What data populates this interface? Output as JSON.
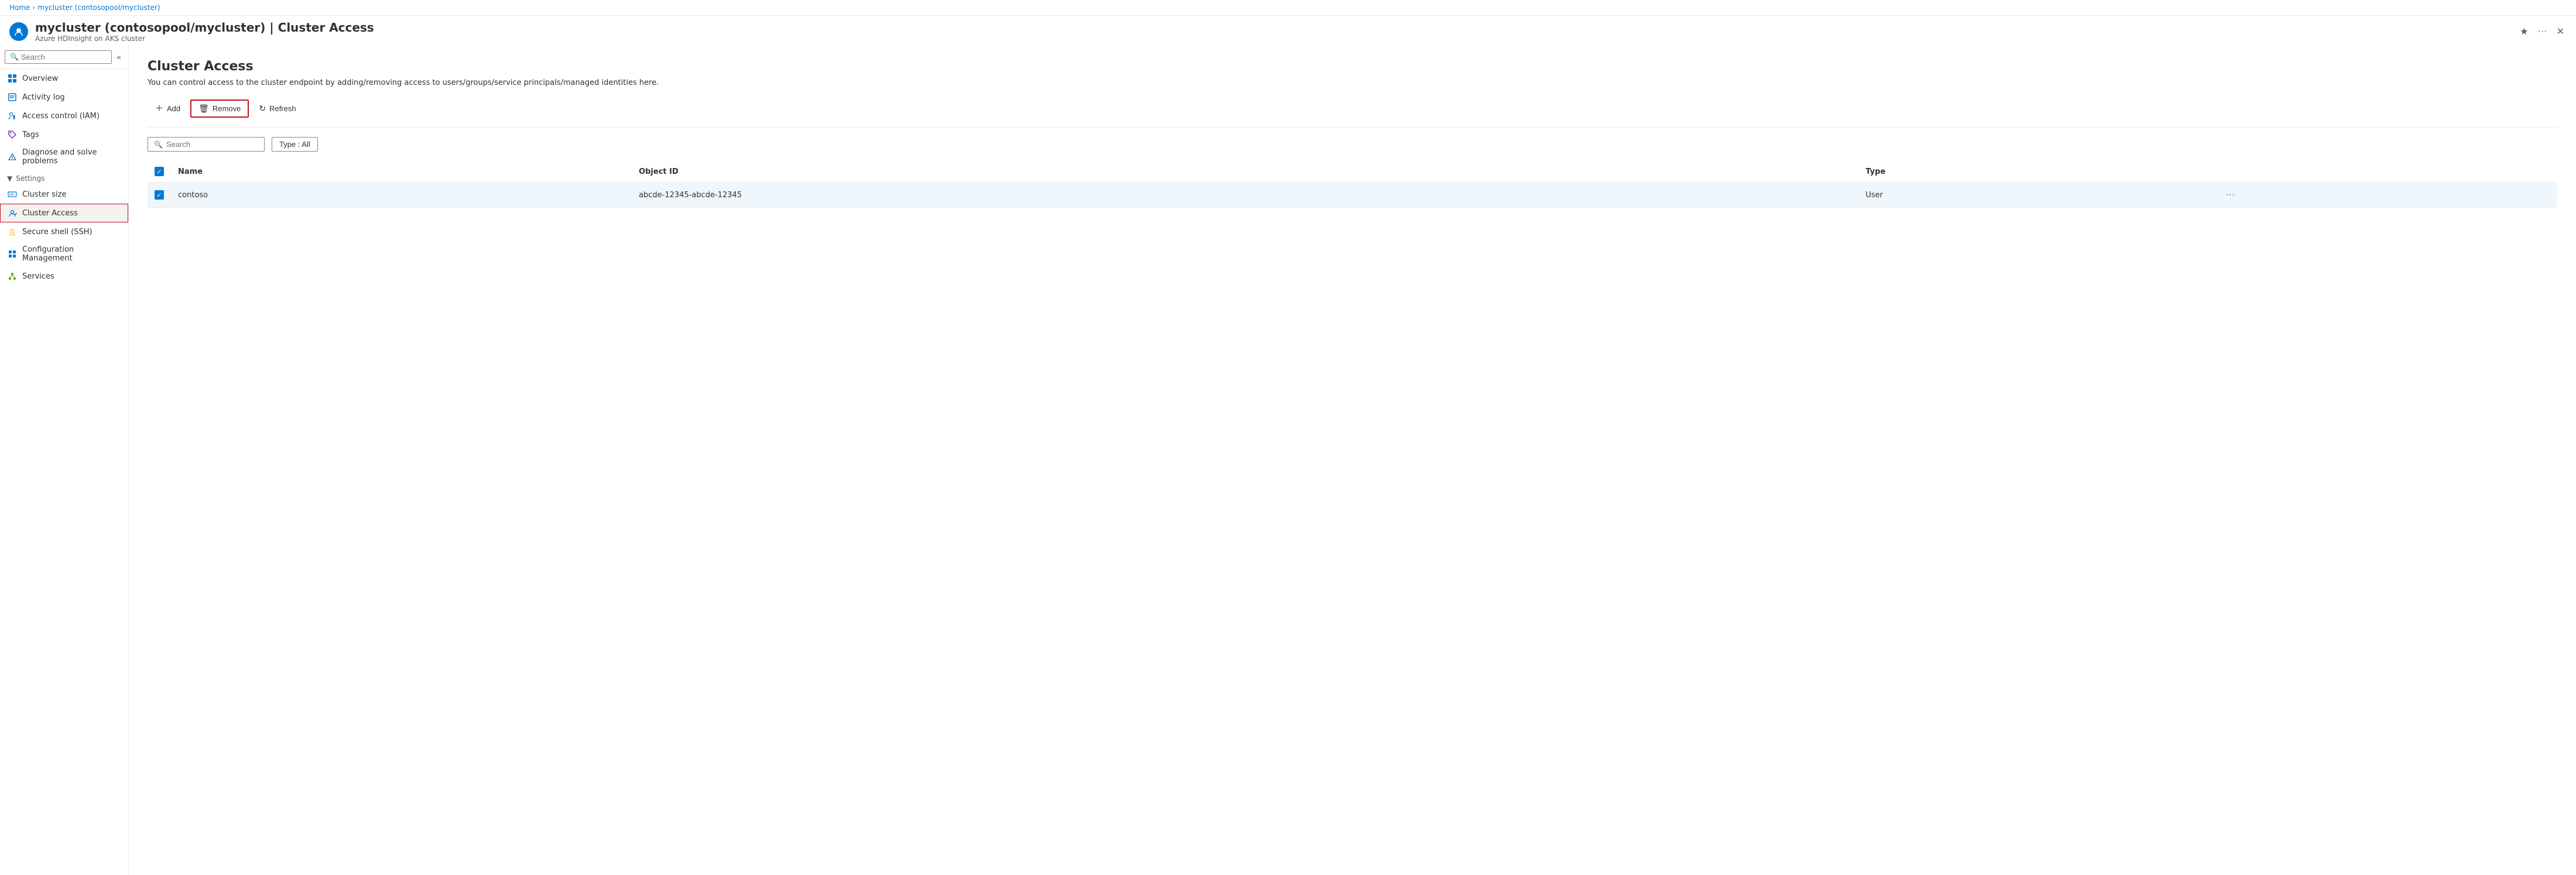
{
  "breadcrumb": {
    "home": "Home",
    "cluster": "mycluster (contosopool/mycluster)"
  },
  "header": {
    "title": "mycluster (contosopool/mycluster) | Cluster Access",
    "subtitle": "Azure HDInsight on AKS cluster",
    "favorite_label": "★",
    "more_label": "···",
    "close_label": "✕"
  },
  "sidebar": {
    "search_placeholder": "Search",
    "collapse_label": "«",
    "nav_items": [
      {
        "id": "overview",
        "label": "Overview",
        "icon": "overview"
      },
      {
        "id": "activity-log",
        "label": "Activity log",
        "icon": "activity"
      },
      {
        "id": "access-control",
        "label": "Access control (IAM)",
        "icon": "iam"
      },
      {
        "id": "tags",
        "label": "Tags",
        "icon": "tags"
      },
      {
        "id": "diagnose",
        "label": "Diagnose and solve problems",
        "icon": "diagnose"
      }
    ],
    "settings_label": "Settings",
    "settings_items": [
      {
        "id": "cluster-size",
        "label": "Cluster size",
        "icon": "clustersize"
      },
      {
        "id": "cluster-access",
        "label": "Cluster Access",
        "icon": "clusteraccess",
        "active": true
      },
      {
        "id": "secure-shell",
        "label": "Secure shell (SSH)",
        "icon": "ssh"
      },
      {
        "id": "config-management",
        "label": "Configuration Management",
        "icon": "config"
      },
      {
        "id": "services",
        "label": "Services",
        "icon": "services"
      }
    ]
  },
  "content": {
    "page_title": "Cluster Access",
    "page_desc": "You can control access to the cluster endpoint by adding/removing access to users/groups/service principals/managed identities here.",
    "toolbar": {
      "add_label": "Add",
      "remove_label": "Remove",
      "refresh_label": "Refresh"
    },
    "filter": {
      "search_placeholder": "Search",
      "type_label": "Type : All"
    },
    "table": {
      "columns": [
        "",
        "Name",
        "Object ID",
        "Type",
        ""
      ],
      "rows": [
        {
          "name": "contoso",
          "object_id": "abcde-12345-abcde-12345",
          "type": "User",
          "selected": true
        }
      ]
    }
  }
}
